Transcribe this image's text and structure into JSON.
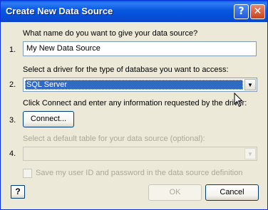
{
  "window": {
    "title": "Create New Data Source",
    "help_button": "?",
    "close_button": "✕"
  },
  "step1": {
    "number": "1.",
    "prompt": "What name do you want to give your data source?",
    "value": "My New Data Source"
  },
  "step2": {
    "number": "2.",
    "prompt": "Select a driver for the type of database you want to access:",
    "selected": "SQL Server"
  },
  "step3": {
    "number": "3.",
    "prompt": "Click Connect and enter any information requested by the driver:",
    "connect_label": "Connect..."
  },
  "step4": {
    "number": "4.",
    "prompt": "Select a default table for your data source (optional):",
    "selected": ""
  },
  "save_checkbox": {
    "label": "Save my user ID and password in the data source definition",
    "checked": false
  },
  "footer": {
    "help_icon_glyph": "?",
    "ok_label": "OK",
    "cancel_label": "Cancel"
  },
  "colors": {
    "titlebar": "#0a5ae5",
    "selection": "#316ac5",
    "dialog_bg": "#ece9d8"
  }
}
